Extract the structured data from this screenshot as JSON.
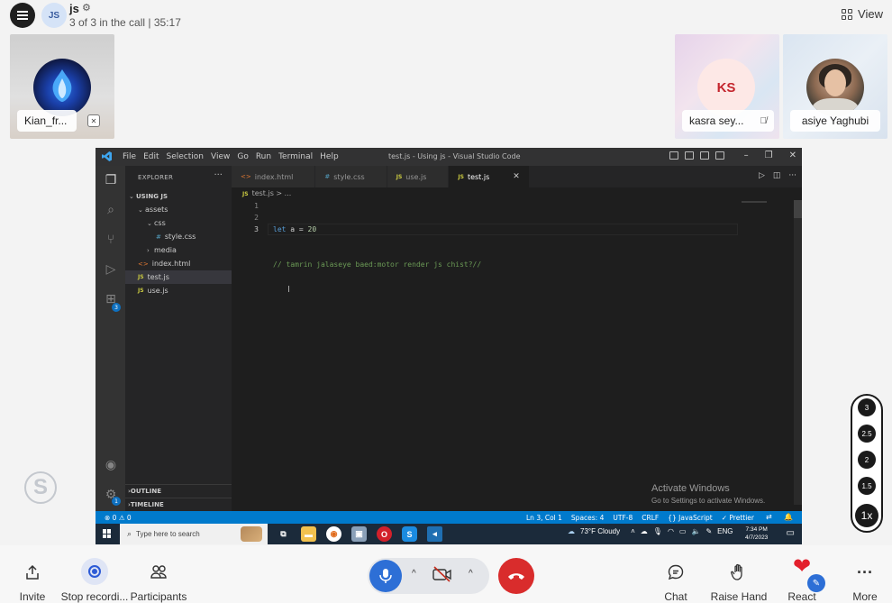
{
  "header": {
    "title": "js",
    "avatar_initials": "JS",
    "status": "3 of 3 in the call | 35:17",
    "view_label": "View"
  },
  "participants": [
    {
      "name": "Kian_fr...",
      "type": "avatar-image"
    },
    {
      "name": "kasra sey...",
      "initials": "KS",
      "muted": true
    },
    {
      "name": "asiye Yaghubi",
      "type": "photo"
    }
  ],
  "vscode": {
    "menu": [
      "File",
      "Edit",
      "Selection",
      "View",
      "Go",
      "Run",
      "Terminal",
      "Help"
    ],
    "window_title": "test.js - Using js - Visual Studio Code",
    "explorer_header": "EXPLORER",
    "tree": [
      {
        "label": "USING JS",
        "kind": "root",
        "depth": 0
      },
      {
        "label": "assets",
        "kind": "folder-open",
        "depth": 1
      },
      {
        "label": "css",
        "kind": "folder-open",
        "depth": 2
      },
      {
        "label": "style.css",
        "kind": "css",
        "depth": 3
      },
      {
        "label": "media",
        "kind": "folder",
        "depth": 2
      },
      {
        "label": "index.html",
        "kind": "html",
        "depth": 1
      },
      {
        "label": "test.js",
        "kind": "js",
        "depth": 1,
        "active": true
      },
      {
        "label": "use.js",
        "kind": "js",
        "depth": 1
      }
    ],
    "outline_label": "OUTLINE",
    "timeline_label": "TIMELINE",
    "tabs": [
      {
        "label": "index.html",
        "icon": "html"
      },
      {
        "label": "style.css",
        "icon": "css"
      },
      {
        "label": "use.js",
        "icon": "js"
      },
      {
        "label": "test.js",
        "icon": "js",
        "active": true
      }
    ],
    "breadcrumb": "test.js > ...",
    "line_numbers": [
      "1",
      "2",
      "3"
    ],
    "code_line1_kw": "let",
    "code_line1_mid": " a = ",
    "code_line1_num": "20",
    "code_line2": "// tamrin jalaseye baed:motor render js chist?//",
    "activate_title": "Activate Windows",
    "activate_sub": "Go to Settings to activate Windows.",
    "status_left": "⊗ 0 ⚠ 0",
    "status_right": [
      "Ln 3, Col 1",
      "Spaces: 4",
      "UTF-8",
      "CRLF",
      "{} JavaScript",
      "✓ Prettier"
    ],
    "extensions_badge": "3",
    "settings_badge": "1"
  },
  "taskbar": {
    "search_placeholder": "Type here to search",
    "weather": "73°F  Cloudy",
    "lang": "ENG",
    "time": "7:34 PM",
    "date": "4/7/2023"
  },
  "zoom_levels": [
    "3",
    "2.5",
    "2",
    "1.5",
    "1x"
  ],
  "toolbar": {
    "invite": "Invite",
    "stop_recording": "Stop recordi...",
    "participants": "Participants",
    "chat": "Chat",
    "raise_hand": "Raise Hand",
    "react": "React",
    "more": "More"
  }
}
